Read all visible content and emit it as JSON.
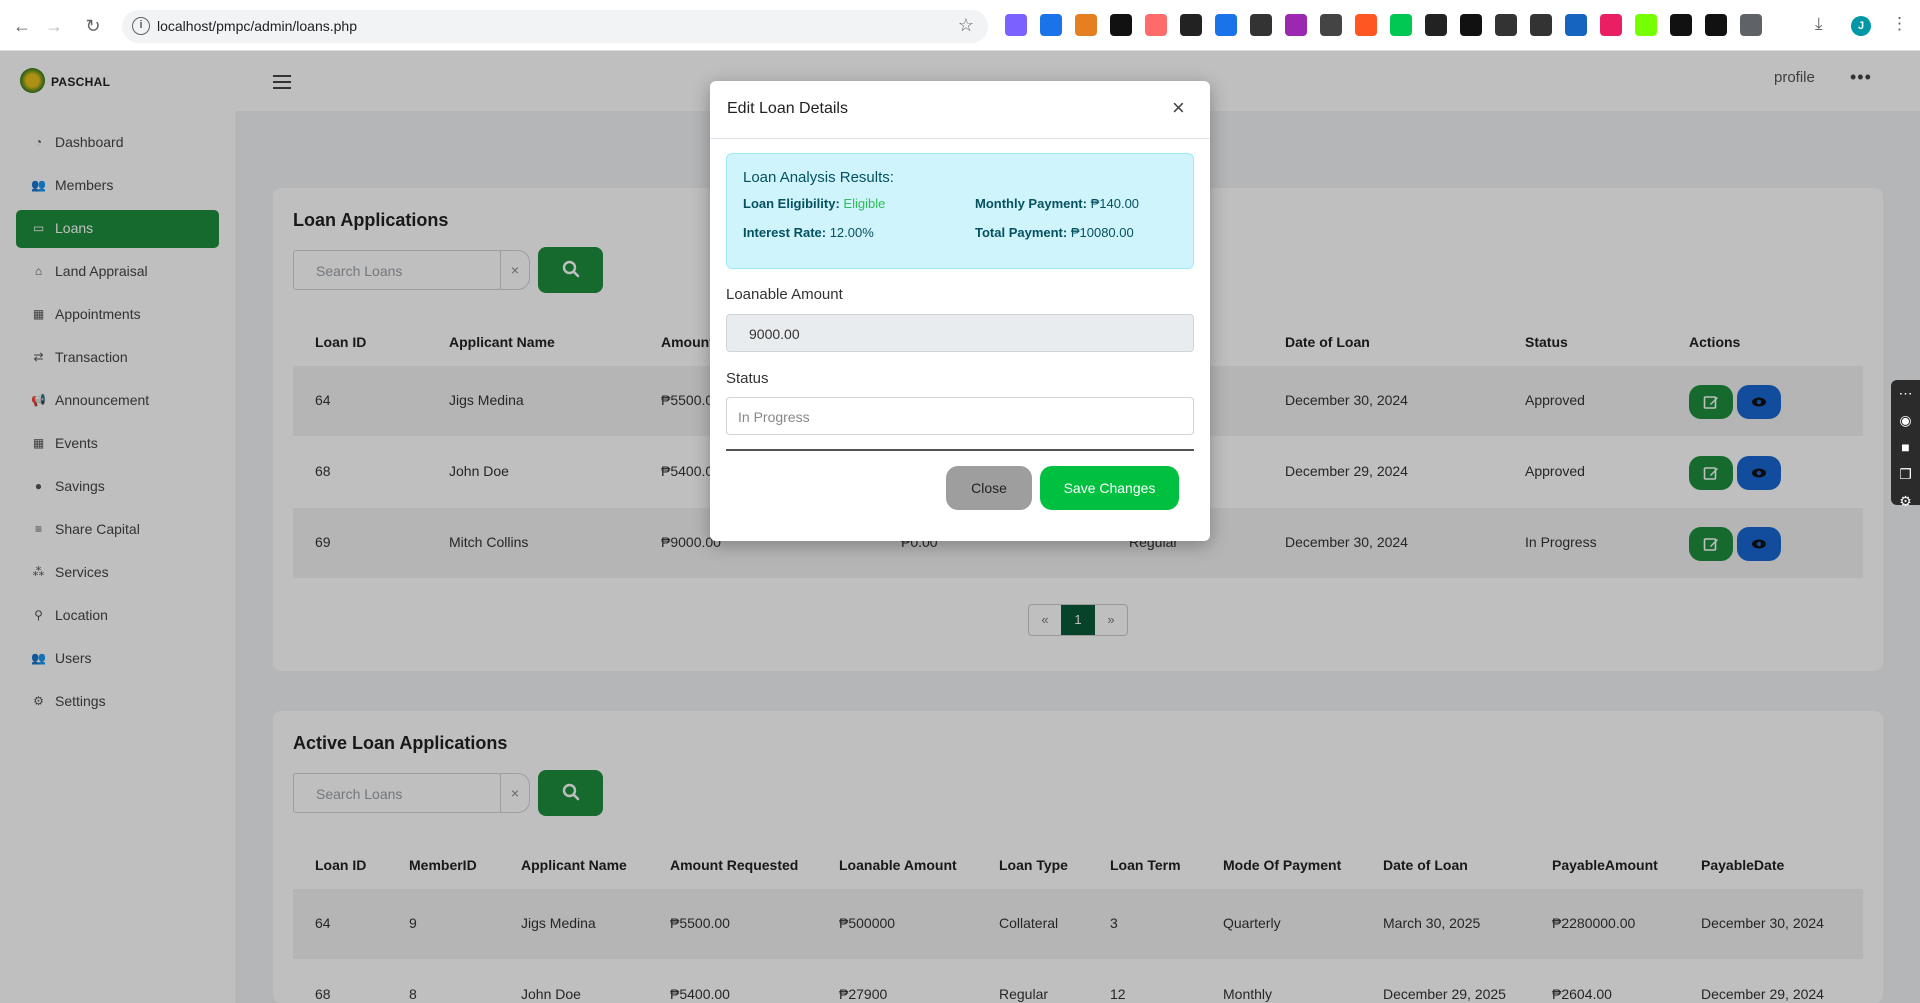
{
  "browser": {
    "url": "localhost/pmpc/admin/loans.php",
    "avatar_letter": "J",
    "extension_colors": [
      "#7b61ff",
      "#1a73e8",
      "#e67e22",
      "#111111",
      "#ff6b6b",
      "#222222",
      "#1a73e8",
      "#333333",
      "#9c27b0",
      "#444444",
      "#ff5722",
      "#00c853",
      "#222222",
      "#111111",
      "#333333",
      "#333333",
      "#1565c0",
      "#e91e63",
      "#76ff03",
      "#111111",
      "#111111",
      "#5f6368"
    ]
  },
  "app": {
    "brand": "PASCHAL",
    "profile_alt": "profile"
  },
  "sidebar": {
    "items": [
      {
        "label": "Dashboard",
        "icon": "dashboard-icon"
      },
      {
        "label": "Members",
        "icon": "users-icon"
      },
      {
        "label": "Loans",
        "icon": "money-icon"
      },
      {
        "label": "Land Appraisal",
        "icon": "bank-icon"
      },
      {
        "label": "Appointments",
        "icon": "calendar-icon"
      },
      {
        "label": "Transaction",
        "icon": "exchange-icon"
      },
      {
        "label": "Announcement",
        "icon": "megaphone-icon"
      },
      {
        "label": "Events",
        "icon": "calendar-icon"
      },
      {
        "label": "Savings",
        "icon": "piggy-bank-icon"
      },
      {
        "label": "Share Capital",
        "icon": "coins-icon"
      },
      {
        "label": "Services",
        "icon": "sitemap-icon"
      },
      {
        "label": "Location",
        "icon": "map-pin-icon"
      },
      {
        "label": "Users",
        "icon": "users-icon"
      },
      {
        "label": "Settings",
        "icon": "gear-icon"
      }
    ],
    "active_index": 2
  },
  "loan_applications": {
    "title": "Loan Applications",
    "search_placeholder": "Search Loans",
    "clear": "×",
    "columns": [
      "Loan ID",
      "Applicant Name",
      "Amount",
      "Date of Loan",
      "Status",
      "Actions"
    ],
    "rows": [
      {
        "id": "64",
        "name": "Jigs Medina",
        "amount": "₱5500.0",
        "loanable": "",
        "type": "",
        "date": "December 30, 2024",
        "status": "Approved"
      },
      {
        "id": "68",
        "name": "John Doe",
        "amount": "₱5400.0",
        "loanable": "",
        "type": "",
        "date": "December 29, 2024",
        "status": "Approved"
      },
      {
        "id": "69",
        "name": "Mitch Collins",
        "amount": "₱9000.00",
        "loanable": "₱0.00",
        "type": "Regular",
        "date": "December 30, 2024",
        "status": "In Progress"
      }
    ],
    "pagination": {
      "prev": "«",
      "current": "1",
      "next": "»"
    }
  },
  "active_loans": {
    "title": "Active Loan Applications",
    "search_placeholder": "Search Loans",
    "clear": "×",
    "columns": [
      "Loan ID",
      "MemberID",
      "Applicant Name",
      "Amount Requested",
      "Loanable Amount",
      "Loan Type",
      "Loan Term",
      "Mode Of Payment",
      "Date of Loan",
      "PayableAmount",
      "PayableDate"
    ],
    "rows": [
      [
        "64",
        "9",
        "Jigs Medina",
        "₱5500.00",
        "₱500000",
        "Collateral",
        "3",
        "Quarterly",
        "March 30, 2025",
        "₱2280000.00",
        "December 30, 2024"
      ],
      [
        "68",
        "8",
        "John Doe",
        "₱5400.00",
        "₱27900",
        "Regular",
        "12",
        "Monthly",
        "December 29, 2025",
        "₱2604.00",
        "December 29, 2024"
      ]
    ]
  },
  "modal": {
    "title": "Edit Loan Details",
    "close_glyph": "×",
    "analysis": {
      "title": "Loan Analysis Results:",
      "eligibility_label": "Loan Eligibility:",
      "eligibility_value": "Eligible",
      "monthly_label": "Monthly Payment:",
      "monthly_value": "₱140.00",
      "rate_label": "Interest Rate:",
      "rate_value": "12.00%",
      "total_label": "Total Payment:",
      "total_value": "₱10080.00"
    },
    "loanable_label": "Loanable Amount",
    "loanable_value": "9000.00",
    "status_label": "Status",
    "status_placeholder": "In Progress",
    "close_button": "Close",
    "save_button": "Save Changes"
  }
}
